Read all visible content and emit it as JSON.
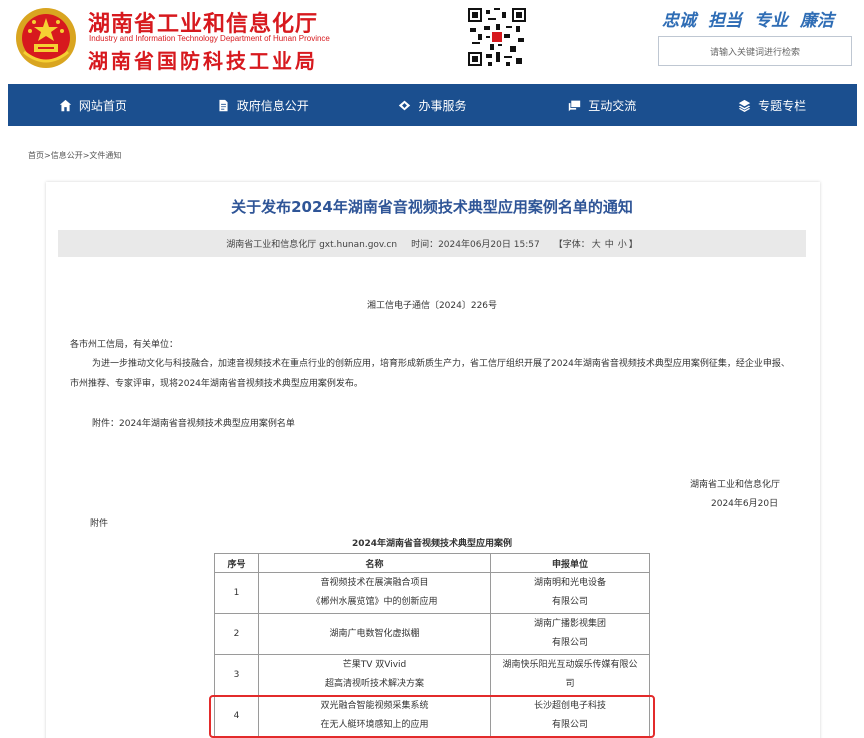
{
  "header": {
    "title_cn1": "湖南省工业和信息化厅",
    "title_en": "Industry and Information Technology Department of Hunan Province",
    "title_cn2": "湖南省国防科技工业局",
    "slogans": [
      "忠诚",
      "担当",
      "专业",
      "廉洁"
    ],
    "search_placeholder": "请输入关键词进行检索"
  },
  "nav": {
    "items": [
      {
        "label": "网站首页",
        "icon": "home-icon"
      },
      {
        "label": "政府信息公开",
        "icon": "document-icon"
      },
      {
        "label": "办事服务",
        "icon": "service-icon"
      },
      {
        "label": "互动交流",
        "icon": "chat-icon"
      },
      {
        "label": "专题专栏",
        "icon": "layers-icon"
      }
    ]
  },
  "breadcrumb": [
    "首页",
    "信息公开",
    "文件通知"
  ],
  "breadcrumb_sep": ">",
  "article": {
    "title": "关于发布2024年湖南省音视频技术典型应用案例名单的通知",
    "source": "湖南省工业和信息化厅 gxt.hunan.gov.cn",
    "time_label": "时间：",
    "time": "2024年06月20日 15:57",
    "font_label_open": "【字体：",
    "font_large": "大",
    "font_medium": "中",
    "font_small": "小",
    "font_label_close": "】",
    "doc_no": "湘工信电子通信〔2024〕226号",
    "greeting": "各市州工信局，有关单位：",
    "body": "为进一步推动文化与科技融合，加速音视频技术在重点行业的创新应用，培育形成新质生产力，省工信厅组织开展了2024年湖南省音视频技术典型应用案例征集，经企业申报、市州推荐、专家评审，现将2024年湖南省音视频技术典型应用案例发布。",
    "attachment_line": "附件：2024年湖南省音视频技术典型应用案例名单",
    "sign_org": "湖南省工业和信息化厅",
    "sign_date": "2024年6月20日",
    "attachment_label": "附件"
  },
  "table": {
    "title": "2024年湖南省音视频技术典型应用案例",
    "headers": {
      "idx": "序号",
      "name": "名称",
      "unit": "申报单位"
    },
    "rows": [
      {
        "idx": "1",
        "name1": "音视频技术在展演融合项目",
        "name2": "《郴州水展览馆》中的创新应用",
        "unit1": "湖南明和光电设备",
        "unit2": "有限公司"
      },
      {
        "idx": "2",
        "name1": "湖南广电数智化虚拟棚",
        "name2": "",
        "unit1": "湖南广播影视集团",
        "unit2": "有限公司"
      },
      {
        "idx": "3",
        "name1": "芒果TV 双Vivid",
        "name2": "超高清视听技术解决方案",
        "unit1": "湖南快乐阳光互动娱乐传媒有限公",
        "unit2": "司"
      },
      {
        "idx": "4",
        "name1": "双光融合智能视频采集系统",
        "name2": "在无人艇环境感知上的应用",
        "unit1": "长沙超创电子科技",
        "unit2": "有限公司"
      }
    ]
  }
}
